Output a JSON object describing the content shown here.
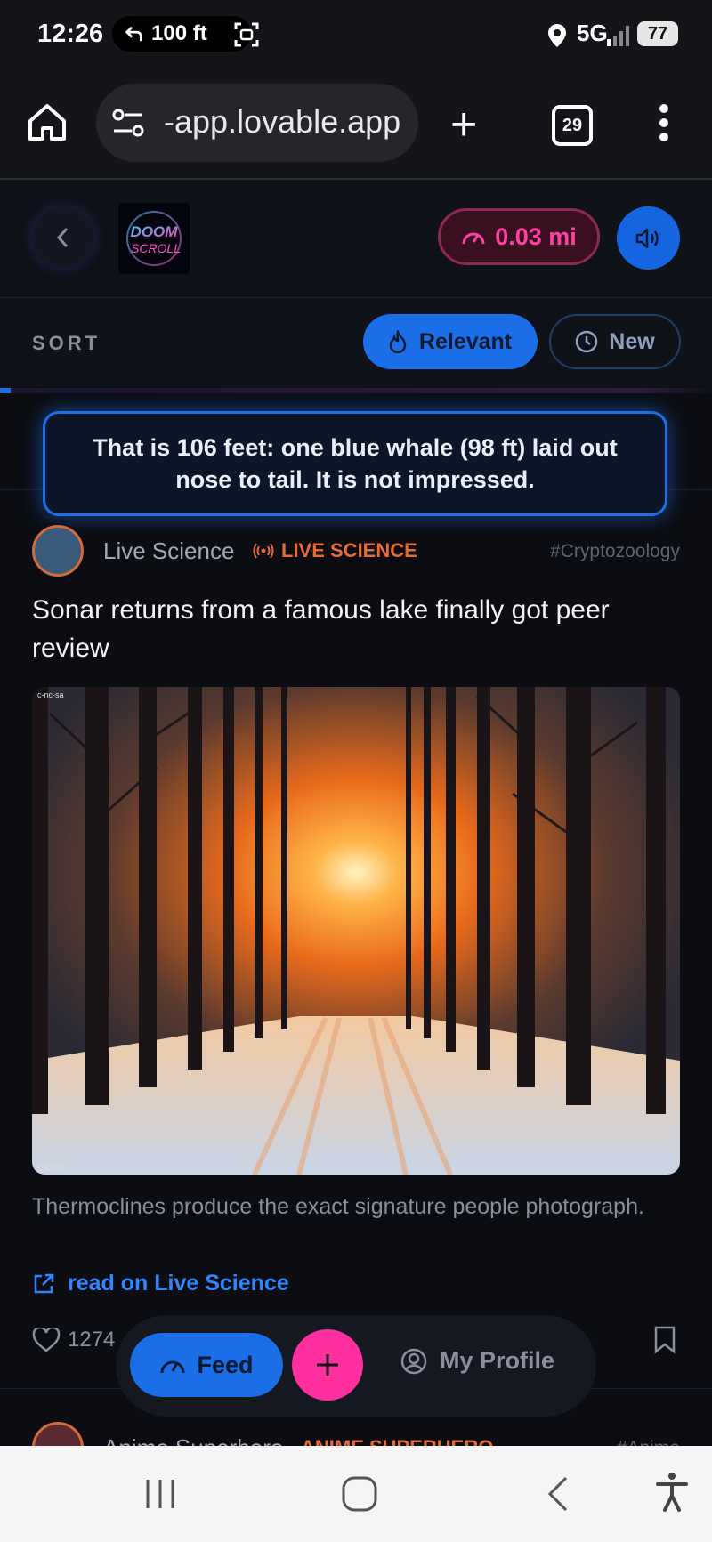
{
  "status_bar": {
    "time": "12:26",
    "pill_text": "100 ft",
    "network": "5G",
    "battery": "77"
  },
  "browser": {
    "url": "-app.lovable.app",
    "tab_count": "29"
  },
  "app_header": {
    "distance": "0.03 mi",
    "logo_text": "DOOM SCROLL"
  },
  "sort": {
    "label": "SORT",
    "relevant": "Relevant",
    "new": "New"
  },
  "toast": {
    "text": "That is 106 feet: one blue whale (98 ft) laid out nose to tail. It is not impressed."
  },
  "post": {
    "source": "Live Science",
    "badge": "LIVE SCIENCE",
    "tag": "#Cryptozoology",
    "headline": "Sonar returns from a famous lake finally got peer review",
    "caption": "Thermoclines produce the exact signature people photograph.",
    "read_link": "read on Live Science",
    "likes": "1274"
  },
  "next_post": {
    "source": "Anime Superhero",
    "badge": "ANIME SUPERHERO",
    "tag": "#Anime"
  },
  "bottom_nav": {
    "feed": "Feed",
    "profile": "My Profile"
  },
  "colors": {
    "accent_blue": "#1a6fe8",
    "accent_pink": "#ff2fa0",
    "badge_orange": "#e86a34"
  }
}
